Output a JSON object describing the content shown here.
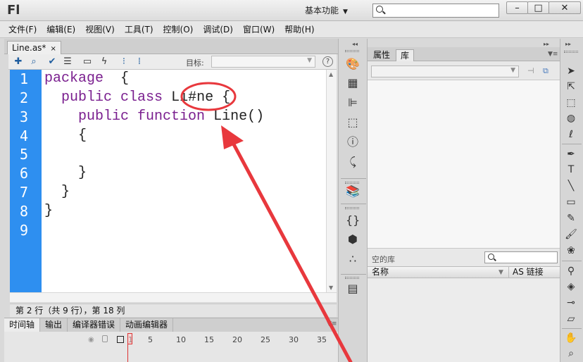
{
  "app": {
    "logo": "Fl",
    "workspace": "基本功能",
    "search_placeholder": ""
  },
  "window_controls": {
    "minimize": "–",
    "maximize": "□",
    "close": "✕"
  },
  "menu": [
    "文件(F)",
    "编辑(E)",
    "视图(V)",
    "工具(T)",
    "控制(O)",
    "调试(D)",
    "窗口(W)",
    "帮助(H)"
  ],
  "document": {
    "tab_label": "Line.as*",
    "tab_close": "×",
    "toolbar_icons": [
      "add-icon",
      "find-icon",
      "check-syntax-icon",
      "auto-format-icon",
      "show-hints-icon",
      "debug-icon",
      "collapse-icon",
      "expand-icon"
    ],
    "target_label": "目标:",
    "target_value": "",
    "help": "?"
  },
  "code": {
    "line_numbers": [
      "1",
      "2",
      "3",
      "4",
      "5",
      "6",
      "7",
      "8",
      "9"
    ],
    "lines": [
      {
        "kw1": "package",
        "rest": "  {"
      },
      {
        "indent": "  ",
        "kw1": "public",
        "kw2": "class",
        "name": "Li#ne",
        "rest": " {"
      },
      {
        "indent": "    ",
        "kw1": "public",
        "kw2": "function",
        "name": "Line",
        "rest": "()"
      },
      {
        "indent": "    ",
        "rest": "{"
      },
      {
        "rest": ""
      },
      {
        "indent": "    ",
        "rest": "}"
      },
      {
        "indent": "  ",
        "rest": "}"
      },
      {
        "rest": "}"
      },
      {
        "rest": ""
      }
    ]
  },
  "status": "第 2 行（共 9 行），第 18 列",
  "timeline": {
    "tabs": [
      "时间轴",
      "输出",
      "编译器错误",
      "动画编辑器"
    ],
    "frame_marks": [
      "1",
      "5",
      "10",
      "15",
      "20",
      "25",
      "30",
      "35"
    ]
  },
  "panel": {
    "tabs": [
      "属性",
      "库"
    ],
    "active_tab": "库",
    "library_name": "",
    "empty_label": "空的库",
    "columns": {
      "name": "名称",
      "link": "AS 链接"
    }
  },
  "colors": {
    "gutter": "#2e8ff0",
    "keyword": "#7a1f8f",
    "annotation": "#e8383d"
  }
}
